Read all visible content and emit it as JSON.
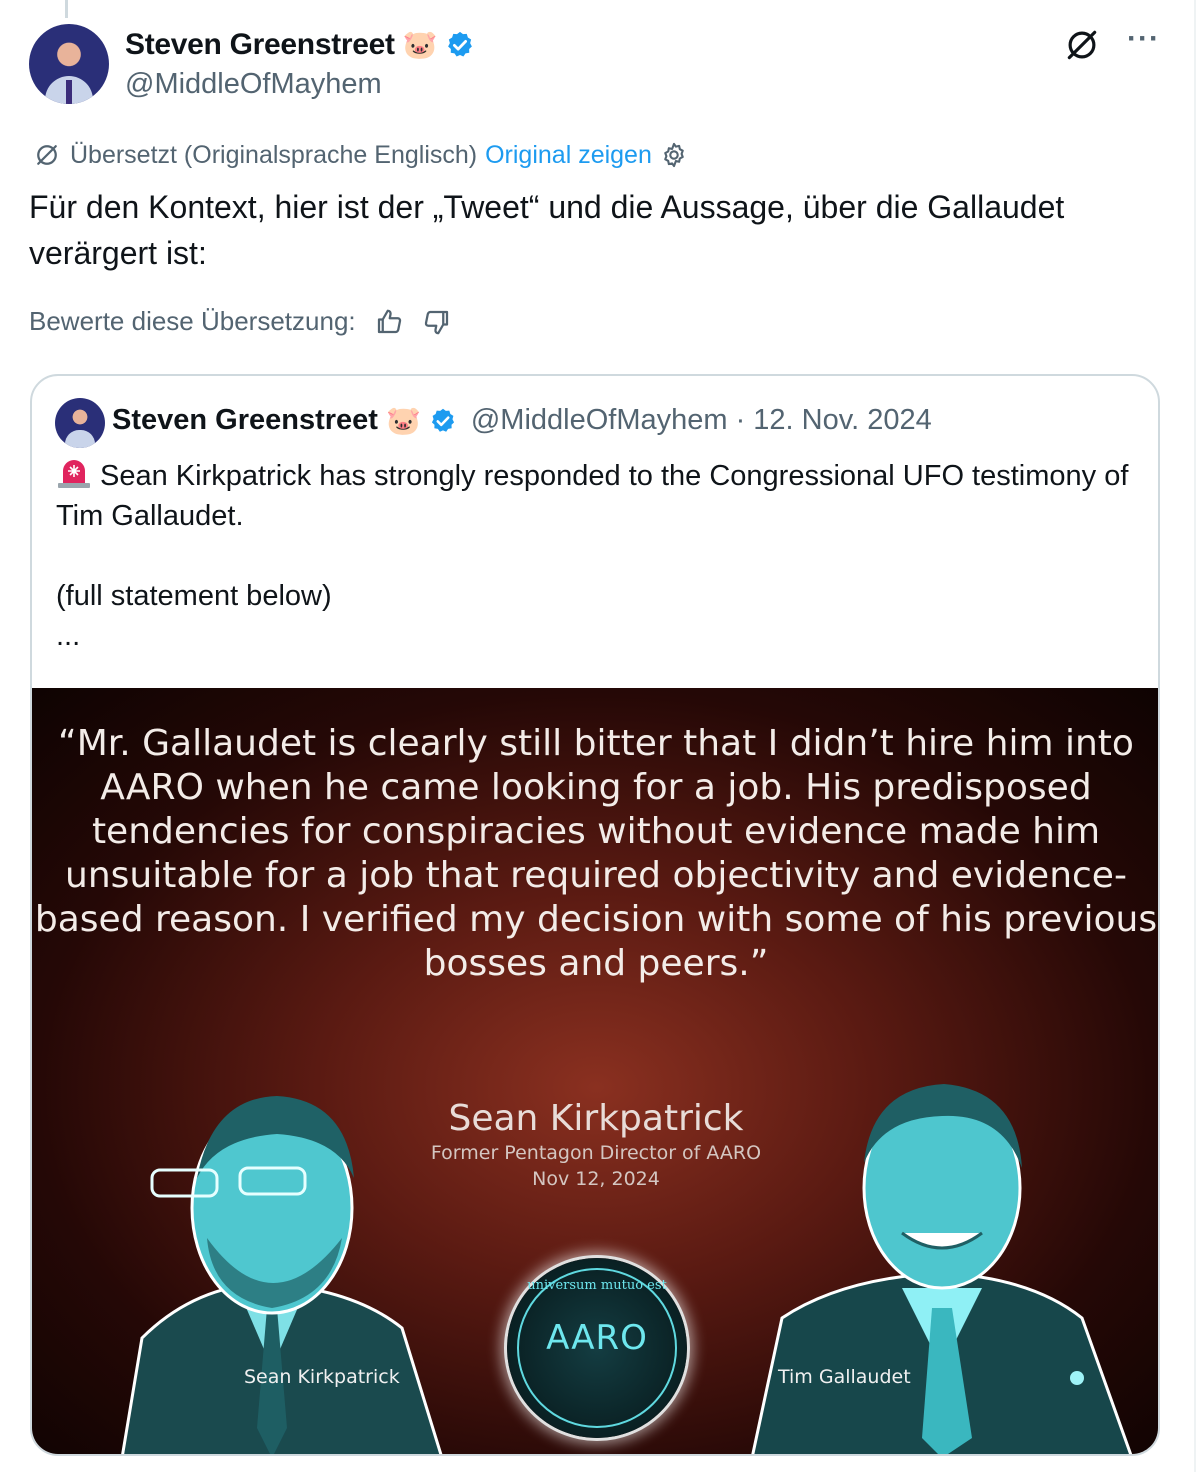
{
  "author": {
    "name": "Steven Greenstreet",
    "pig_emoji": "🐷",
    "handle": "@MiddleOfMayhem"
  },
  "header": {
    "more_label": "···"
  },
  "translation": {
    "status": "Übersetzt (Originalsprache Englisch)",
    "show_original": "Original zeigen",
    "rate_label": "Bewerte diese Übersetzung:"
  },
  "tweet": {
    "text": "Für den Kontext, hier ist der „Tweet“ und die Aussage, über die Gallaudet verärgert ist:"
  },
  "quoted": {
    "name": "Steven Greenstreet",
    "pig_emoji": "🐷",
    "handle_date": "@MiddleOfMayhem · 12. Nov. 2024",
    "text": "Sean Kirkpatrick has strongly responded to the Congressional UFO testimony of Tim Gallaudet.\n\n(full statement below)\n...",
    "image": {
      "quote": "“Mr. Gallaudet is clearly still bitter that I didn’t hire him into AARO when he came looking for a job. His predisposed tendencies for conspiracies without evidence made him unsuitable for a job that required objectivity and evidence-based reason. I verified my decision with some of his previous bosses and peers.”",
      "speaker_name": "Sean Kirkpatrick",
      "speaker_role": "Former Pentagon Director of AARO",
      "speaker_date": "Nov 12, 2024",
      "left_caption": "Sean Kirkpatrick",
      "right_caption": "Tim Gallaudet",
      "seal_text": "AARO",
      "seal_motto": "universum mutuo est"
    }
  },
  "colors": {
    "link": "#1d9bf0",
    "muted": "#536471",
    "verified": "#1d9bf0",
    "image_tint": "#6ee7ee"
  },
  "icons": {
    "verified": "verified-badge-icon",
    "translate": "translate-icon",
    "gear": "gear-icon",
    "thumbs_up": "thumbs-up-icon",
    "thumbs_down": "thumbs-down-icon",
    "grok": "slashed-circle-icon",
    "more": "more-icon",
    "siren": "siren-icon"
  }
}
